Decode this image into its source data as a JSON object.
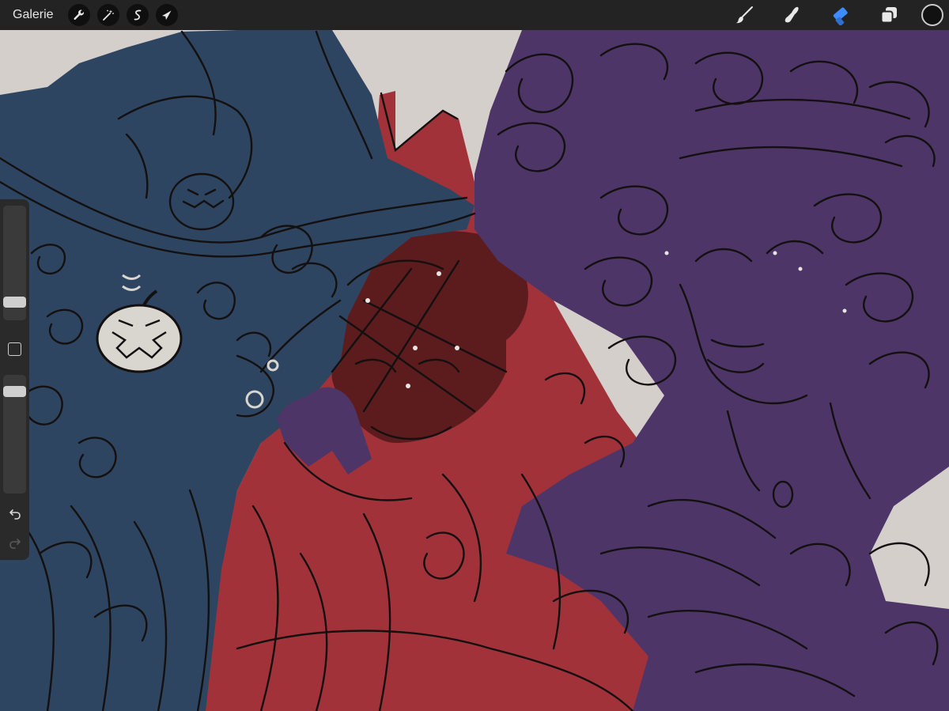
{
  "toolbar": {
    "gallery_label": "Galerie",
    "left_tools": [
      "wrench-icon",
      "magic-wand-icon",
      "selection-icon",
      "transform-arrow-icon"
    ],
    "right_tools": [
      "brush-icon",
      "smudge-icon",
      "eraser-icon",
      "layers-icon"
    ],
    "active_tool": "eraser-icon",
    "active_color": "#111111",
    "accent_color": "#3d8bfd"
  },
  "sidebar": {
    "brush_size": 0.12,
    "brush_opacity": 0.1
  },
  "canvas": {
    "background": "#d4cfca",
    "palette": {
      "blue": "#2d4560",
      "red": "#a2323a",
      "dark_red": "#5c1c1e",
      "purple": "#4e3567",
      "lineart": "#141010",
      "pumpkin": "#d9d5cf"
    }
  }
}
